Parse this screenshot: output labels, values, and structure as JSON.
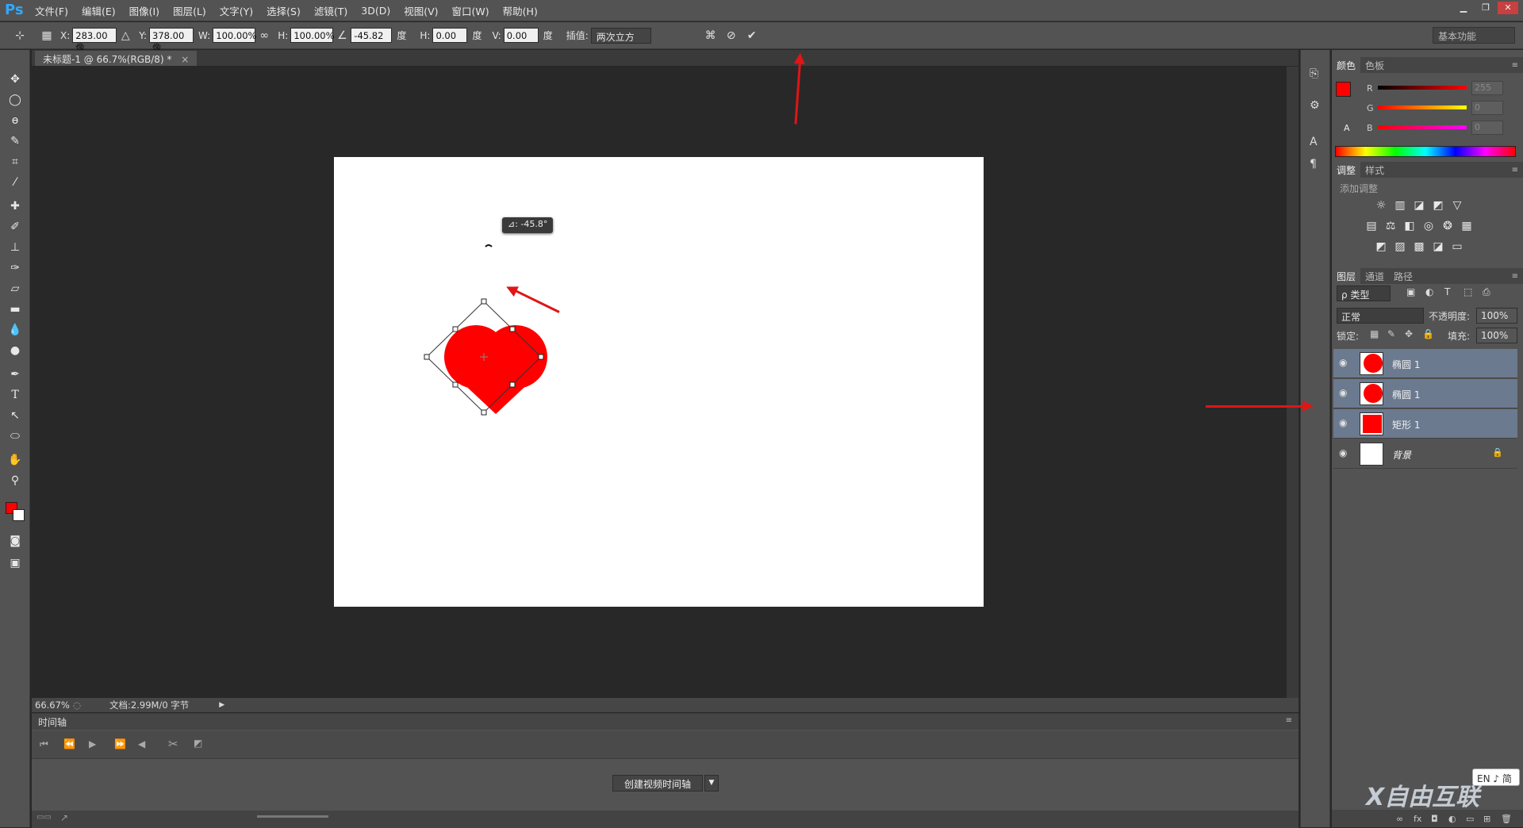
{
  "app": {
    "logo": "Ps"
  },
  "menu": [
    "文件(F)",
    "编辑(E)",
    "图像(I)",
    "图层(L)",
    "文字(Y)",
    "选择(S)",
    "滤镜(T)",
    "3D(D)",
    "视图(V)",
    "窗口(W)",
    "帮助(H)"
  ],
  "options": {
    "x_label": "X:",
    "x_value": "283.00 像",
    "y_label": "Y:",
    "y_value": "378.00 像",
    "w_label": "W:",
    "w_value": "100.00%",
    "h_label": "H:",
    "h_value": "100.00%",
    "angle_value": "-45.82",
    "angle_unit": "度",
    "hskew_label": "H:",
    "hskew_value": "0.00",
    "hskew_unit": "度",
    "vskew_label": "V:",
    "vskew_value": "0.00",
    "vskew_unit": "度",
    "interp_label": "插值:",
    "interp_value": "两次立方",
    "workspace": "基本功能"
  },
  "document": {
    "tab_label": "未标题-1 @ 66.7%(RGB/8) *",
    "rotate_tooltip": "⊿: -45.8°",
    "heart_color": "#ff0000"
  },
  "status": {
    "zoom": "66.67%",
    "doc_info": "文档:2.99M/0 字节"
  },
  "timeline": {
    "title": "时间轴",
    "create_button": "创建视频时间轴"
  },
  "color_panel": {
    "tabs": [
      "颜色",
      "色板"
    ],
    "r_label": "R",
    "g_label": "G",
    "b_label": "B",
    "r_value": "255",
    "g_value": "0",
    "b_value": "0",
    "foreground": "#ff0000",
    "background": "#ffffff"
  },
  "adjust_panel": {
    "tabs": [
      "调整",
      "样式"
    ],
    "hint": "添加调整"
  },
  "layers_panel": {
    "tabs": [
      "图层",
      "通道",
      "路径"
    ],
    "filter_label": "ρ 类型",
    "blend_mode": "正常",
    "opacity_label": "不透明度:",
    "opacity_value": "100%",
    "lock_label": "锁定:",
    "fill_label": "填充:",
    "fill_value": "100%",
    "layers": [
      {
        "name": "椭圆 1",
        "selected": true,
        "kind": "ellipse"
      },
      {
        "name": "椭圆 1",
        "selected": true,
        "kind": "ellipse"
      },
      {
        "name": "矩形 1",
        "selected": true,
        "kind": "rect"
      },
      {
        "name": "背景",
        "selected": false,
        "kind": "background"
      }
    ]
  },
  "ime": "EN ♪ 简",
  "watermark": "X自由互联"
}
